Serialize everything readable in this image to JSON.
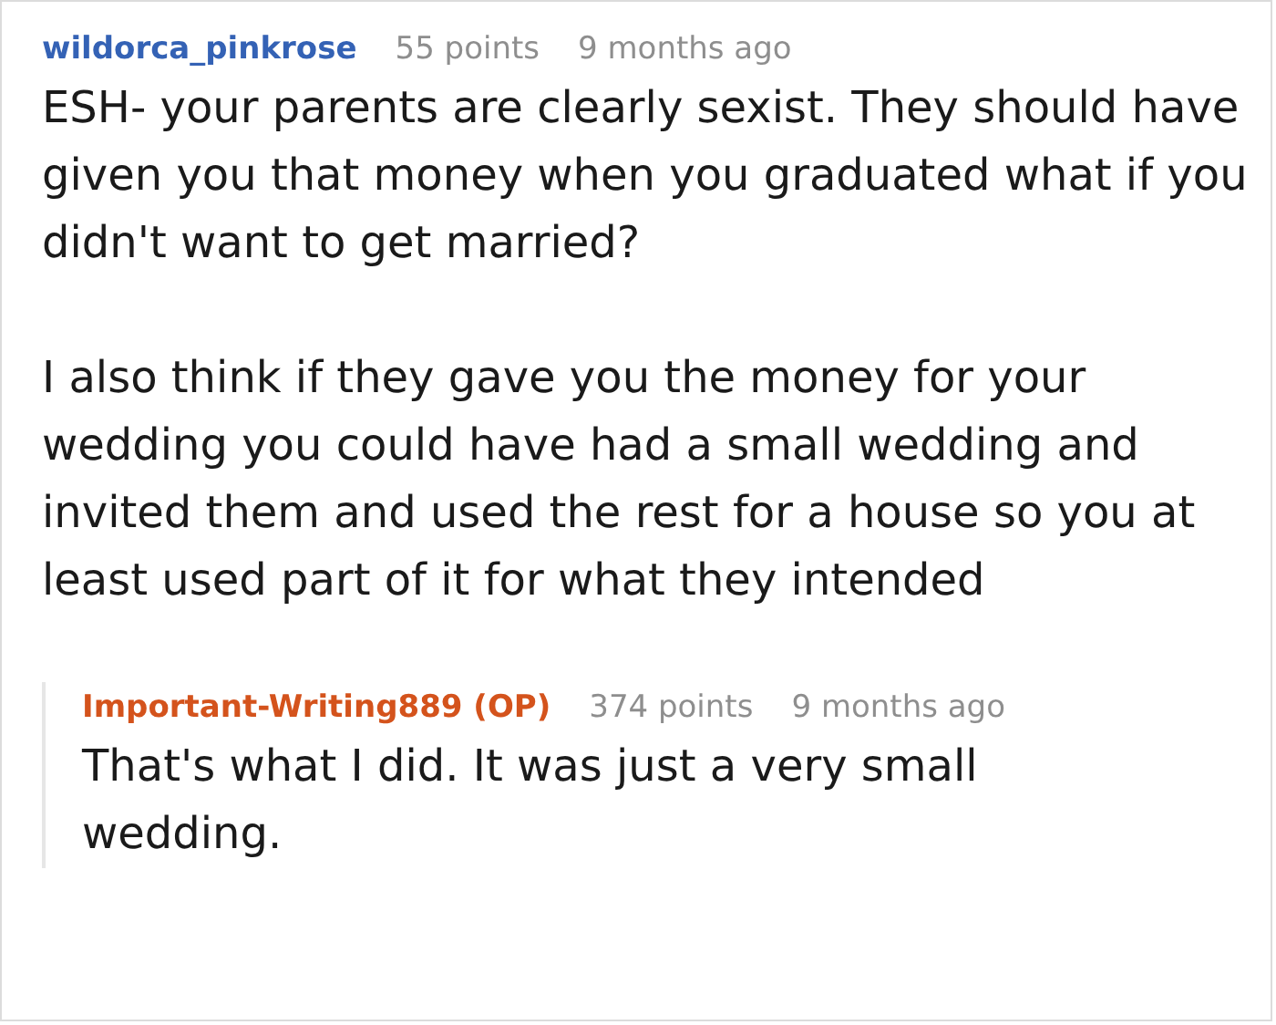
{
  "comments": [
    {
      "author": "wildorca_pinkrose",
      "kind": "user",
      "points": "55 points",
      "time": "9 months ago",
      "paragraphs": [
        "ESH- your parents are clearly sexist. They should have given you that money when you graduated what if you didn't want to get married?",
        "I also think if they gave you the money for your wedding you could have had a small wedding and invited them and used the rest for a house so you at least used part of it for what they intended"
      ],
      "children": [
        {
          "author": "Important-Writing889 (OP)",
          "kind": "op",
          "points": "374 points",
          "time": "9 months ago",
          "paragraphs": [
            "That's what I did. It was just a very small wedding."
          ]
        }
      ]
    }
  ]
}
